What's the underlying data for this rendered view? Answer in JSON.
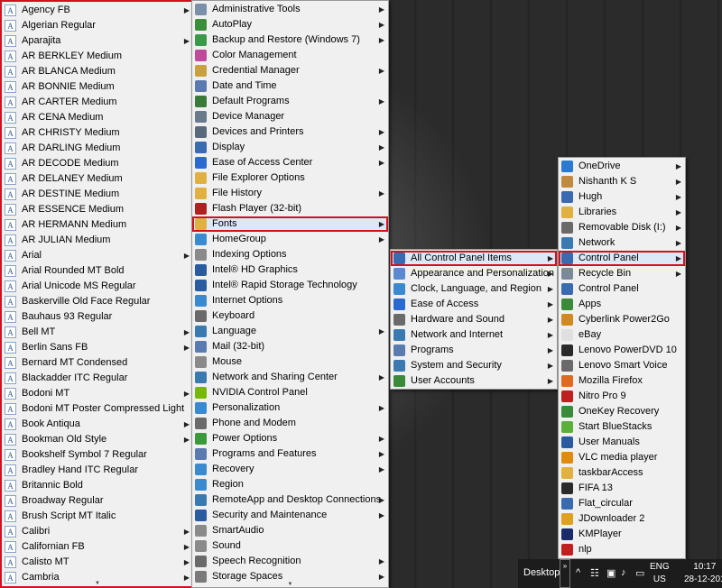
{
  "fonts_menu": {
    "items": [
      {
        "label": "Agency FB",
        "arrow": true
      },
      {
        "label": "Algerian Regular",
        "arrow": false
      },
      {
        "label": "Aparajita",
        "arrow": true
      },
      {
        "label": "AR BERKLEY Medium",
        "arrow": false
      },
      {
        "label": "AR BLANCA Medium",
        "arrow": false
      },
      {
        "label": "AR BONNIE Medium",
        "arrow": false
      },
      {
        "label": "AR CARTER Medium",
        "arrow": false
      },
      {
        "label": "AR CENA Medium",
        "arrow": false
      },
      {
        "label": "AR CHRISTY Medium",
        "arrow": false
      },
      {
        "label": "AR DARLING Medium",
        "arrow": false
      },
      {
        "label": "AR DECODE Medium",
        "arrow": false
      },
      {
        "label": "AR DELANEY Medium",
        "arrow": false
      },
      {
        "label": "AR DESTINE Medium",
        "arrow": false
      },
      {
        "label": "AR ESSENCE Medium",
        "arrow": false
      },
      {
        "label": "AR HERMANN Medium",
        "arrow": false
      },
      {
        "label": "AR JULIAN Medium",
        "arrow": false
      },
      {
        "label": "Arial",
        "arrow": true
      },
      {
        "label": "Arial Rounded MT Bold",
        "arrow": false
      },
      {
        "label": "Arial Unicode MS Regular",
        "arrow": false
      },
      {
        "label": "Baskerville Old Face Regular",
        "arrow": false
      },
      {
        "label": "Bauhaus 93 Regular",
        "arrow": false
      },
      {
        "label": "Bell MT",
        "arrow": true
      },
      {
        "label": "Berlin Sans FB",
        "arrow": true
      },
      {
        "label": "Bernard MT Condensed",
        "arrow": false
      },
      {
        "label": "Blackadder ITC Regular",
        "arrow": false
      },
      {
        "label": "Bodoni MT",
        "arrow": true
      },
      {
        "label": "Bodoni MT Poster Compressed Light",
        "arrow": false
      },
      {
        "label": "Book Antiqua",
        "arrow": true
      },
      {
        "label": "Bookman Old Style",
        "arrow": true
      },
      {
        "label": "Bookshelf Symbol 7 Regular",
        "arrow": false
      },
      {
        "label": "Bradley Hand ITC Regular",
        "arrow": false
      },
      {
        "label": "Britannic Bold",
        "arrow": false
      },
      {
        "label": "Broadway Regular",
        "arrow": false
      },
      {
        "label": "Brush Script MT Italic",
        "arrow": false
      },
      {
        "label": "Calibri",
        "arrow": true
      },
      {
        "label": "Californian FB",
        "arrow": true
      },
      {
        "label": "Calisto MT",
        "arrow": true
      },
      {
        "label": "Cambria",
        "arrow": true
      }
    ]
  },
  "control_panel_menu": {
    "items": [
      {
        "label": "Administrative Tools",
        "arrow": true,
        "icon": "admin-tools-icon",
        "color": "#7a8fa8"
      },
      {
        "label": "AutoPlay",
        "arrow": true,
        "icon": "autoplay-icon",
        "color": "#3b8f3b"
      },
      {
        "label": "Backup and Restore (Windows 7)",
        "arrow": true,
        "icon": "backup-icon",
        "color": "#3a9a4a"
      },
      {
        "label": "Color Management",
        "arrow": false,
        "icon": "color-management-icon",
        "color": "#c04a9a"
      },
      {
        "label": "Credential Manager",
        "arrow": true,
        "icon": "credential-icon",
        "color": "#c8a040"
      },
      {
        "label": "Date and Time",
        "arrow": false,
        "icon": "clock-icon",
        "color": "#5a7ab0"
      },
      {
        "label": "Default Programs",
        "arrow": true,
        "icon": "default-programs-icon",
        "color": "#3a7a3a"
      },
      {
        "label": "Device Manager",
        "arrow": false,
        "icon": "device-manager-icon",
        "color": "#6a7a8a"
      },
      {
        "label": "Devices and Printers",
        "arrow": true,
        "icon": "printer-icon",
        "color": "#5a6a7a"
      },
      {
        "label": "Display",
        "arrow": true,
        "icon": "display-icon",
        "color": "#3a6ab0"
      },
      {
        "label": "Ease of Access Center",
        "arrow": true,
        "icon": "ease-of-access-icon",
        "color": "#2a6ad0"
      },
      {
        "label": "File Explorer Options",
        "arrow": false,
        "icon": "folder-options-icon",
        "color": "#e0b040"
      },
      {
        "label": "File History",
        "arrow": true,
        "icon": "file-history-icon",
        "color": "#e0b040"
      },
      {
        "label": "Flash Player (32-bit)",
        "arrow": false,
        "icon": "flash-icon",
        "color": "#b02020"
      },
      {
        "label": "Fonts",
        "arrow": true,
        "icon": "fonts-folder-icon",
        "color": "#e0b040",
        "highlight": true
      },
      {
        "label": "HomeGroup",
        "arrow": true,
        "icon": "homegroup-icon",
        "color": "#3a8ad0"
      },
      {
        "label": "Indexing Options",
        "arrow": false,
        "icon": "indexing-icon",
        "color": "#8a8a8a"
      },
      {
        "label": "Intel® HD Graphics",
        "arrow": false,
        "icon": "intel-icon",
        "color": "#2a5aa0"
      },
      {
        "label": "Intel® Rapid Storage Technology",
        "arrow": false,
        "icon": "intel-storage-icon",
        "color": "#2a5aa0"
      },
      {
        "label": "Internet Options",
        "arrow": false,
        "icon": "internet-options-icon",
        "color": "#3a8ad0"
      },
      {
        "label": "Keyboard",
        "arrow": false,
        "icon": "keyboard-icon",
        "color": "#6a6a6a"
      },
      {
        "label": "Language",
        "arrow": true,
        "icon": "language-icon",
        "color": "#3a7ab0"
      },
      {
        "label": "Mail (32-bit)",
        "arrow": false,
        "icon": "mail-icon",
        "color": "#5a7ab0"
      },
      {
        "label": "Mouse",
        "arrow": false,
        "icon": "mouse-icon",
        "color": "#8a8a8a"
      },
      {
        "label": "Network and Sharing Center",
        "arrow": true,
        "icon": "network-icon",
        "color": "#3a7ab0"
      },
      {
        "label": "NVIDIA Control Panel",
        "arrow": false,
        "icon": "nvidia-icon",
        "color": "#76b900"
      },
      {
        "label": "Personalization",
        "arrow": true,
        "icon": "personalization-icon",
        "color": "#3a8ad0"
      },
      {
        "label": "Phone and Modem",
        "arrow": false,
        "icon": "phone-icon",
        "color": "#6a6a6a"
      },
      {
        "label": "Power Options",
        "arrow": true,
        "icon": "power-icon",
        "color": "#3a9a3a"
      },
      {
        "label": "Programs and Features",
        "arrow": true,
        "icon": "programs-icon",
        "color": "#5a7ab0"
      },
      {
        "label": "Recovery",
        "arrow": true,
        "icon": "recovery-icon",
        "color": "#3a8ad0"
      },
      {
        "label": "Region",
        "arrow": false,
        "icon": "region-icon",
        "color": "#3a8ad0"
      },
      {
        "label": "RemoteApp and Desktop Connections",
        "arrow": true,
        "icon": "remoteapp-icon",
        "color": "#3a7ab0"
      },
      {
        "label": "Security and Maintenance",
        "arrow": true,
        "icon": "flag-icon",
        "color": "#2a5aa0"
      },
      {
        "label": "SmartAudio",
        "arrow": false,
        "icon": "smartaudio-icon",
        "color": "#8a8a8a"
      },
      {
        "label": "Sound",
        "arrow": false,
        "icon": "sound-icon",
        "color": "#8a8a8a"
      },
      {
        "label": "Speech Recognition",
        "arrow": true,
        "icon": "microphone-icon",
        "color": "#6a6a6a"
      },
      {
        "label": "Storage Spaces",
        "arrow": true,
        "icon": "storage-spaces-icon",
        "color": "#7a7a7a"
      }
    ]
  },
  "control_panel_submenu": {
    "items": [
      {
        "label": "All Control Panel Items",
        "arrow": true,
        "icon": "control-panel-icon",
        "color": "#3a6ab0",
        "highlight": true
      },
      {
        "label": "Appearance and Personalization",
        "arrow": true,
        "icon": "appearance-icon",
        "color": "#5a8ad0"
      },
      {
        "label": "Clock, Language, and Region",
        "arrow": true,
        "icon": "globe-clock-icon",
        "color": "#3a8ad0"
      },
      {
        "label": "Ease of Access",
        "arrow": true,
        "icon": "ease-of-access-icon",
        "color": "#2a6ad0"
      },
      {
        "label": "Hardware and Sound",
        "arrow": true,
        "icon": "hardware-icon",
        "color": "#6a6a6a"
      },
      {
        "label": "Network and Internet",
        "arrow": true,
        "icon": "network-icon",
        "color": "#3a7ab0"
      },
      {
        "label": "Programs",
        "arrow": true,
        "icon": "programs-icon",
        "color": "#5a7ab0"
      },
      {
        "label": "System and Security",
        "arrow": true,
        "icon": "shield-icon",
        "color": "#3a7ab0"
      },
      {
        "label": "User Accounts",
        "arrow": true,
        "icon": "user-accounts-icon",
        "color": "#3a8a3a"
      }
    ]
  },
  "user_menu": {
    "items": [
      {
        "label": "OneDrive",
        "arrow": true,
        "icon": "onedrive-icon",
        "color": "#2a7ad0"
      },
      {
        "label": "Nishanth K S",
        "arrow": true,
        "icon": "user-icon",
        "color": "#c08a40"
      },
      {
        "label": "Hugh",
        "arrow": true,
        "icon": "computer-icon",
        "color": "#3a6ab0"
      },
      {
        "label": "Libraries",
        "arrow": true,
        "icon": "libraries-icon",
        "color": "#e0b040"
      },
      {
        "label": "Removable Disk (I:)",
        "arrow": true,
        "icon": "removable-disk-icon",
        "color": "#6a6a6a"
      },
      {
        "label": "Network",
        "arrow": true,
        "icon": "network-icon",
        "color": "#3a7ab0"
      },
      {
        "label": "Control Panel",
        "arrow": true,
        "icon": "control-panel-icon",
        "color": "#3a6ab0",
        "highlight": true
      },
      {
        "label": "Recycle Bin",
        "arrow": true,
        "icon": "recycle-bin-icon",
        "color": "#7a8a9a"
      },
      {
        "label": "Control Panel",
        "arrow": false,
        "icon": "control-panel-icon",
        "color": "#3a6ab0"
      },
      {
        "label": "Apps",
        "arrow": false,
        "icon": "apps-icon",
        "color": "#3a8a3a"
      },
      {
        "label": "Cyberlink Power2Go",
        "arrow": false,
        "icon": "power2go-icon",
        "color": "#d08a20"
      },
      {
        "label": "eBay",
        "arrow": false,
        "icon": "ebay-icon",
        "color": "#e0e0e0"
      },
      {
        "label": "Lenovo PowerDVD 10",
        "arrow": false,
        "icon": "powerdvd-icon",
        "color": "#2a2a2a"
      },
      {
        "label": "Lenovo Smart Voice",
        "arrow": false,
        "icon": "smart-voice-icon",
        "color": "#6a6a6a"
      },
      {
        "label": "Mozilla Firefox",
        "arrow": false,
        "icon": "firefox-icon",
        "color": "#e06a20"
      },
      {
        "label": "Nitro Pro 9",
        "arrow": false,
        "icon": "nitro-icon",
        "color": "#c02020"
      },
      {
        "label": "OneKey Recovery",
        "arrow": false,
        "icon": "onekey-icon",
        "color": "#3a8a3a"
      },
      {
        "label": "Start BlueStacks",
        "arrow": false,
        "icon": "bluestacks-icon",
        "color": "#5ab03a"
      },
      {
        "label": "User Manuals",
        "arrow": false,
        "icon": "manuals-icon",
        "color": "#2a5aa0"
      },
      {
        "label": "VLC media player",
        "arrow": false,
        "icon": "vlc-icon",
        "color": "#e08a10"
      },
      {
        "label": "taskbarAccess",
        "arrow": false,
        "icon": "folder-icon",
        "color": "#e0b040"
      },
      {
        "label": "FIFA 13",
        "arrow": false,
        "icon": "fifa-icon",
        "color": "#2a2a2a"
      },
      {
        "label": "Flat_circular",
        "arrow": false,
        "icon": "document-icon",
        "color": "#3a6ab0"
      },
      {
        "label": "JDownloader 2",
        "arrow": false,
        "icon": "jdownloader-icon",
        "color": "#e0a020"
      },
      {
        "label": "KMPlayer",
        "arrow": false,
        "icon": "kmplayer-icon",
        "color": "#1a2a6a"
      },
      {
        "label": "nlp",
        "arrow": false,
        "icon": "pdf-icon",
        "color": "#c02020"
      }
    ]
  },
  "taskbar": {
    "desktop_label": "Desktop",
    "language": "ENG",
    "region": "US",
    "time": "10:17",
    "date": "28-12-201"
  }
}
